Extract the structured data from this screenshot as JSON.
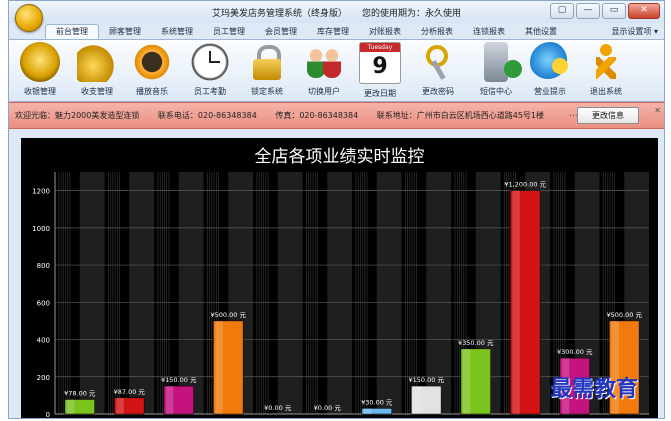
{
  "window": {
    "title": "艾玛美发店务管理系统（终身版）",
    "license": "您的使用期为：永久使用",
    "controls": [
      "▢",
      "—",
      "▭",
      "✕"
    ]
  },
  "tabs": [
    "前台管理",
    "顾客管理",
    "系统管理",
    "员工管理",
    "会员管理",
    "库存管理",
    "对账报表",
    "分析报表",
    "连锁报表",
    "其他设置"
  ],
  "active_tab": "前台管理",
  "settings_menu": "显示设置项 ▾",
  "ribbon": [
    {
      "label": "收银管理",
      "icon": "coins-icon"
    },
    {
      "label": "收支管理",
      "icon": "cash-icon"
    },
    {
      "label": "播放音乐",
      "icon": "music-icon"
    },
    {
      "label": "员工考勤",
      "icon": "clock-icon"
    },
    {
      "label": "锁定系统",
      "icon": "lock-icon"
    },
    {
      "label": "切换用户",
      "icon": "users-icon"
    },
    {
      "label": "更改日期",
      "icon": "calendar-icon",
      "cal_top": "Tuesday",
      "cal_day": "9"
    },
    {
      "label": "更改密码",
      "icon": "keys-icon"
    },
    {
      "label": "短信中心",
      "icon": "sms-icon"
    },
    {
      "label": "营业提示",
      "icon": "chat-icon"
    },
    {
      "label": "退出系统",
      "icon": "exit-icon"
    }
  ],
  "infobar": {
    "welcome": "欢迎光临：魅力2000美发造型连锁",
    "phone": "联系电话：020-86348384",
    "fax": "传真：020-86348384",
    "address": "联系地址：广州市白云区机场西心道路45号1楼",
    "dots": "...",
    "button": "更改信息",
    "close": "✕"
  },
  "watermark": "最需教育",
  "colors": {
    "accent": "#c62a2a",
    "chart_bg": "#000000",
    "grid": "#5a5a5a",
    "text": "#ffffff"
  },
  "chart_data": {
    "type": "bar",
    "title": "全店各项业绩实时监控",
    "ylim": [
      0,
      1300
    ],
    "yticks": [
      0,
      200,
      400,
      600,
      800,
      1000,
      1200
    ],
    "grid": true,
    "xlabel": "",
    "ylabel": "",
    "categories": [
      "",
      "",
      "",
      "",
      "",
      "",
      "",
      "",
      "",
      "",
      "",
      ""
    ],
    "values": [
      78,
      87,
      150,
      500,
      0,
      0,
      30,
      150,
      350,
      1200,
      300,
      500
    ],
    "labels": [
      "¥78.00 元",
      "¥87.00 元",
      "¥150.00 元",
      "¥500.00 元",
      "¥0.00 元",
      "¥0.00 元",
      "¥30.00 元",
      "¥150.00 元",
      "¥350.00 元",
      "¥1,200.00 元",
      "¥300.00 元",
      "¥500.00 元"
    ],
    "bar_colors": [
      "#7bc31d",
      "#d41414",
      "#c4127e",
      "#f07a0c",
      "#9ab0c8",
      "#a8a8a8",
      "#6fb8ef",
      "#e2e2e2",
      "#7bc31d",
      "#d41414",
      "#c4127e",
      "#f07a0c"
    ]
  }
}
